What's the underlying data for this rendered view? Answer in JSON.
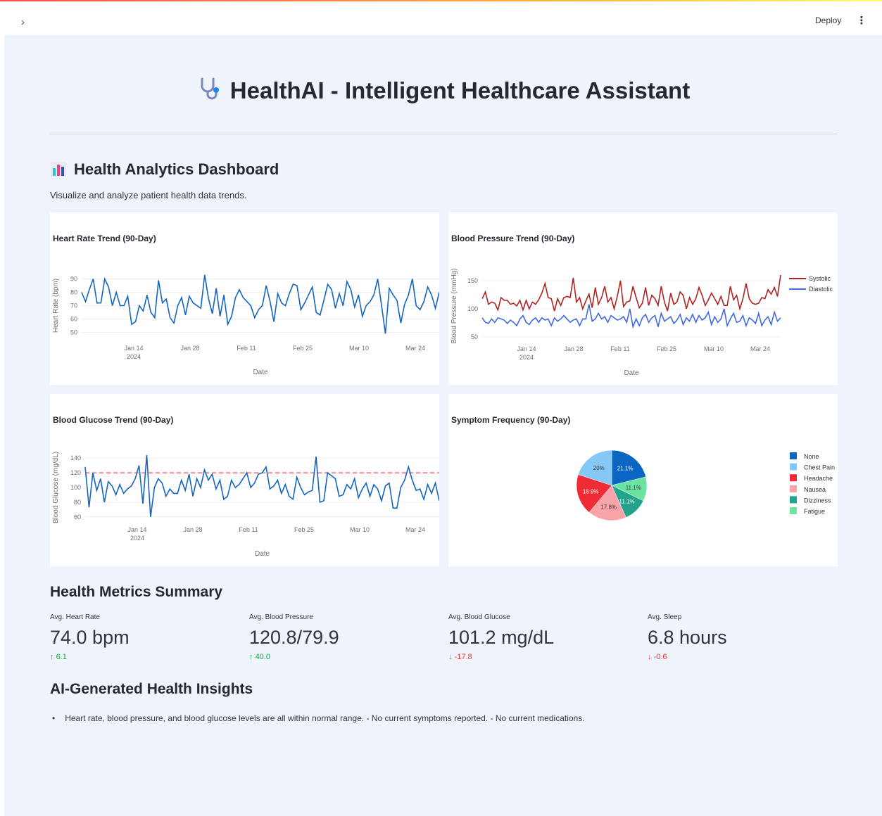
{
  "header": {
    "deploy_label": "Deploy",
    "menu_icon": "kebab-menu-icon",
    "sidebar_toggle_icon": "chevron-right-icon"
  },
  "app": {
    "title": "HealthAI - Intelligent Healthcare Assistant",
    "title_icon": "stethoscope-icon"
  },
  "dashboard": {
    "heading": "Health Analytics Dashboard",
    "heading_icon": "bar-chart-icon",
    "description": "Visualize and analyze patient health data trends."
  },
  "chart_data": [
    {
      "type": "line",
      "title": "Heart Rate Trend (90-Day)",
      "xlabel": "Date",
      "ylabel": "Heart Rate (bpm)",
      "x_ticks": [
        "Jan 14",
        "Jan 28",
        "Feb 11",
        "Feb 25",
        "Mar 10",
        "Mar 24"
      ],
      "x_tick_year": "2024",
      "y_ticks": [
        50,
        60,
        70,
        80,
        90
      ],
      "ylim": [
        45,
        95
      ],
      "series": [
        {
          "values": [
            80,
            73,
            82,
            90,
            72,
            72,
            90,
            84,
            70,
            80,
            70,
            70,
            77,
            56,
            58,
            70,
            66,
            78,
            65,
            61,
            89,
            72,
            75,
            61,
            57,
            70,
            76,
            63,
            77,
            72,
            70,
            68,
            93,
            75,
            64,
            83,
            62,
            78,
            56,
            62,
            76,
            82,
            76,
            73,
            70,
            61,
            67,
            70,
            85,
            73,
            58,
            79,
            72,
            70,
            79,
            86,
            85,
            67,
            72,
            78,
            84,
            65,
            63,
            74,
            86,
            82,
            68,
            79,
            70,
            88,
            82,
            69,
            78,
            62,
            70,
            73,
            78,
            90,
            70,
            49,
            83,
            78,
            74,
            57,
            71,
            78,
            90,
            70,
            67,
            73,
            84,
            78,
            68,
            80
          ]
        }
      ],
      "grid": true
    },
    {
      "type": "line",
      "title": "Blood Pressure Trend (90-Day)",
      "xlabel": "Date",
      "ylabel": "Blood Pressure (mmHg)",
      "x_ticks": [
        "Jan 14",
        "Jan 28",
        "Feb 11",
        "Feb 25",
        "Mar 10",
        "Mar 24"
      ],
      "x_tick_year": "2024",
      "y_ticks": [
        50,
        100,
        150
      ],
      "ylim": [
        45,
        165
      ],
      "legend": "right",
      "series": [
        {
          "name": "Systolic",
          "color": "#b22222",
          "values": [
            118,
            130,
            108,
            112,
            110,
            98,
            120,
            115,
            115,
            108,
            110,
            105,
            115,
            98,
            115,
            100,
            112,
            108,
            116,
            128,
            145,
            120,
            118,
            96,
            118,
            106,
            120,
            122,
            120,
            155,
            112,
            120,
            100,
            114,
            126,
            102,
            138,
            108,
            120,
            140,
            112,
            120,
            100,
            122,
            150,
            104,
            112,
            114,
            140,
            120,
            102,
            110,
            138,
            106,
            124,
            118,
            106,
            140,
            112,
            96,
            128,
            108,
            112,
            130,
            124,
            100,
            120,
            108,
            118,
            138,
            124,
            106,
            116,
            128,
            118,
            108,
            122,
            106,
            106,
            140,
            116,
            124,
            100,
            118,
            145,
            118,
            110,
            108,
            110,
            120,
            118,
            134,
            126,
            138,
            122,
            160
          ]
        },
        {
          "name": "Diastolic",
          "color": "#4169e1",
          "values": [
            84,
            76,
            74,
            82,
            76,
            84,
            82,
            80,
            74,
            80,
            76,
            70,
            82,
            88,
            76,
            72,
            80,
            84,
            76,
            84,
            80,
            82,
            70,
            84,
            78,
            82,
            88,
            82,
            76,
            80,
            82,
            70,
            82,
            82,
            108,
            78,
            82,
            92,
            82,
            86,
            76,
            88,
            84,
            80,
            82,
            86,
            76,
            100,
            68,
            82,
            70,
            84,
            90,
            76,
            84,
            88,
            68,
            92,
            78,
            82,
            86,
            74,
            80,
            90,
            72,
            84,
            78,
            90,
            76,
            88,
            80,
            84,
            94,
            72,
            86,
            76,
            82,
            100,
            70,
            82,
            92,
            76,
            78,
            88,
            70,
            84,
            80,
            74,
            92,
            70,
            80,
            86,
            72,
            94,
            78,
            84
          ]
        }
      ],
      "grid": true
    },
    {
      "type": "line",
      "title": "Blood Glucose Trend (90-Day)",
      "xlabel": "Date",
      "ylabel": "Blood Glucose (mg/dL)",
      "x_ticks": [
        "Jan 14",
        "Jan 28",
        "Feb 11",
        "Feb 25",
        "Mar 10",
        "Mar 24"
      ],
      "x_tick_year": "2024",
      "y_ticks": [
        60,
        80,
        100,
        120,
        140
      ],
      "ylim": [
        55,
        145
      ],
      "reference_line": {
        "value": 120,
        "color": "#ff4444",
        "style": "dashed"
      },
      "series": [
        {
          "values": [
            128,
            73,
            120,
            96,
            112,
            80,
            108,
            102,
            90,
            104,
            92,
            98,
            102,
            112,
            130,
            78,
            144,
            60,
            100,
            112,
            106,
            88,
            98,
            92,
            92,
            110,
            96,
            118,
            88,
            112,
            100,
            124,
            110,
            118,
            98,
            110,
            84,
            88,
            110,
            100,
            104,
            112,
            120,
            100,
            106,
            118,
            120,
            128,
            98,
            102,
            110,
            92,
            104,
            88,
            84,
            114,
            100,
            90,
            94,
            96,
            142,
            80,
            82,
            120,
            116,
            112,
            88,
            90,
            104,
            98,
            112,
            86,
            98,
            106,
            88,
            104,
            98,
            82,
            102,
            106,
            72,
            72,
            100,
            110,
            128,
            110,
            96,
            98,
            84,
            104,
            92,
            106,
            82
          ]
        }
      ],
      "grid": true
    },
    {
      "type": "pie",
      "title": "Symptom Frequency (90-Day)",
      "legend": "right",
      "slices": [
        {
          "label": "None",
          "value": 21.1,
          "text": "21.1%",
          "color": "#0a66c2"
        },
        {
          "label": "Fatigue",
          "value": 11.1,
          "text": "11.1%",
          "color": "#6be4a0"
        },
        {
          "label": "Dizziness",
          "value": 11.1,
          "text": "11.1%",
          "color": "#23a38c"
        },
        {
          "label": "Nausea",
          "value": 17.8,
          "text": "17.8%",
          "color": "#f7a3a8"
        },
        {
          "label": "Headache",
          "value": 18.9,
          "text": "18.9%",
          "color": "#ef2b36"
        },
        {
          "label": "Chest Pain",
          "value": 20.0,
          "text": "20%",
          "color": "#84c8f5"
        }
      ],
      "legend_order": [
        "None",
        "Chest Pain",
        "Headache",
        "Nausea",
        "Dizziness",
        "Fatigue"
      ]
    }
  ],
  "summary": {
    "heading": "Health Metrics Summary",
    "metrics": [
      {
        "label": "Avg. Heart Rate",
        "value": "74.0 bpm",
        "delta": "6.1",
        "delta_icon": "arrow-up-icon",
        "direction": "up"
      },
      {
        "label": "Avg. Blood Pressure",
        "value": "120.8/79.9",
        "delta": "40.0",
        "delta_icon": "arrow-up-icon",
        "direction": "up"
      },
      {
        "label": "Avg. Blood Glucose",
        "value": "101.2 mg/dL",
        "delta": "-17.8",
        "delta_icon": "arrow-down-icon",
        "direction": "down"
      },
      {
        "label": "Avg. Sleep",
        "value": "6.8 hours",
        "delta": "-0.6",
        "delta_icon": "arrow-down-icon",
        "direction": "down"
      }
    ]
  },
  "insights": {
    "heading": "AI-Generated Health Insights",
    "items": [
      "Heart rate, blood pressure, and blood glucose levels are all within normal range. - No current symptoms reported. - No current medications."
    ]
  },
  "colors": {
    "accent_line": "#1f77b4",
    "up": "#09ab3b",
    "down": "#ff2b2b",
    "background": "#eff4fc"
  }
}
